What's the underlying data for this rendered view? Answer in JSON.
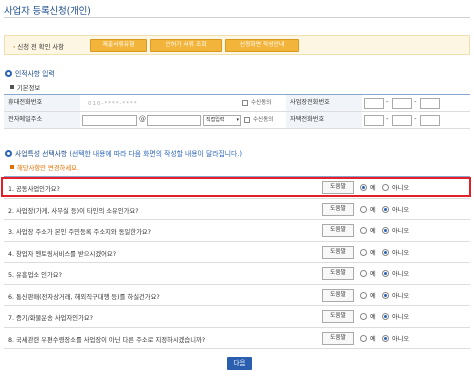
{
  "page_title": "사업자 등록신청(개인)",
  "notice": {
    "label": "신청 전 확인 사항",
    "buttons": [
      "제출서류유형",
      "인허가 서류 조회",
      "신청화면 작성안내"
    ]
  },
  "personal_section": {
    "title": "인적사항 입력",
    "basic_label": "기본정보",
    "mobile_label": "휴대전화번호",
    "mobile_value": "010-****-****",
    "mobile_consent": "수신동의",
    "biz_phone_label": "사업장전화번호",
    "email_label": "전자메일주소",
    "email_at": "@",
    "email_select": "직접입력",
    "email_consent": "수신동의",
    "home_phone_label": "자택전화번호"
  },
  "feature_section": {
    "title": "사업특성 선택사항",
    "description": "(선택한 내용에 따라 다음 화면의 작성할 내용이 달라집니다.)",
    "sub_label": "해당사항만 변경하세요."
  },
  "questions": [
    {
      "text": "1. 공동사업인가요?",
      "help": "도움말",
      "selected": "yes"
    },
    {
      "text": "2. 사업장(가게, 사무실 등)이 타인의 소유인가요?",
      "help": "도움말",
      "selected": "no"
    },
    {
      "text": "3. 사업장 주소가 본인 주민등록 주소지와 동일한가요?",
      "help": "도움말",
      "selected": "no"
    },
    {
      "text": "4. 창업자 멘토링서비스를 받으시겠어요?",
      "help": "도움말",
      "selected": "no"
    },
    {
      "text": "5. 유흥업소 인가요?",
      "help": "도움말",
      "selected": "no"
    },
    {
      "text": "6. 통신판매(전자상거래, 해외직구대행 등)를 하실건가요?",
      "help": "도움말",
      "selected": "no"
    },
    {
      "text": "7. 증기/화물운송 사업자인가요?",
      "help": "도움말",
      "selected": "no"
    },
    {
      "text": "8. 국세관련 우편수령장소를 사업장이 아닌 다른 주소로 지정하시겠습니까?",
      "help": "도움말",
      "selected": "no"
    }
  ],
  "radio_labels": {
    "yes": "예",
    "no": "아니오"
  },
  "next_button": "다음",
  "colors": {
    "accent": "#2a5fb0",
    "highlight": "#e3202a",
    "notice_button": "#f2b43a"
  }
}
